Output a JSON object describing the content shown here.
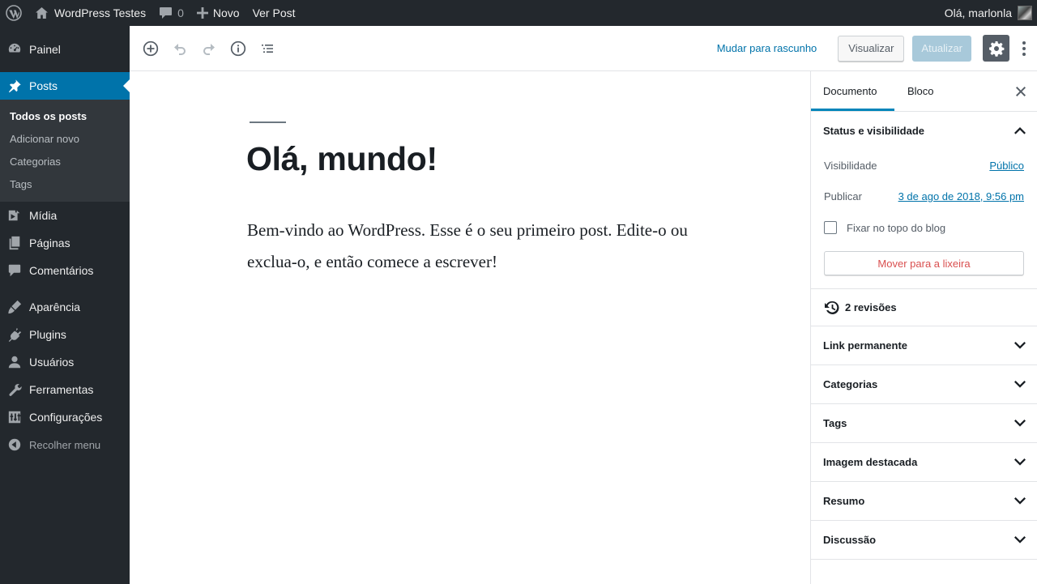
{
  "admin_bar": {
    "site_name": "WordPress Testes",
    "comments_count": "0",
    "new_label": "Novo",
    "view_post_label": "Ver Post",
    "greeting": "Olá, marlonla"
  },
  "sidebar": {
    "items": [
      {
        "label": "Painel",
        "icon": "dashboard-icon"
      },
      {
        "label": "Posts",
        "icon": "pin-icon"
      },
      {
        "label": "Mídia",
        "icon": "media-icon"
      },
      {
        "label": "Páginas",
        "icon": "pages-icon"
      },
      {
        "label": "Comentários",
        "icon": "comments-icon"
      },
      {
        "label": "Aparência",
        "icon": "appearance-icon"
      },
      {
        "label": "Plugins",
        "icon": "plugins-icon"
      },
      {
        "label": "Usuários",
        "icon": "users-icon"
      },
      {
        "label": "Ferramentas",
        "icon": "tools-icon"
      },
      {
        "label": "Configurações",
        "icon": "settings-icon"
      }
    ],
    "submenu": [
      "Todos os posts",
      "Adicionar novo",
      "Categorias",
      "Tags"
    ],
    "collapse_label": "Recolher menu"
  },
  "toolbar": {
    "switch_to_draft": "Mudar para rascunho",
    "preview": "Visualizar",
    "update": "Atualizar"
  },
  "post": {
    "title": "Olá, mundo!",
    "body": "Bem-vindo ao WordPress. Esse é o seu primeiro post. Edite-o ou exclua-o, e então comece a escrever!"
  },
  "panel": {
    "tabs": [
      "Documento",
      "Bloco"
    ],
    "status": {
      "title": "Status e visibilidade",
      "visibility_label": "Visibilidade",
      "visibility_value": "Público",
      "publish_label": "Publicar",
      "publish_value": "3 de ago de 2018, 9:56 pm",
      "sticky_label": "Fixar no topo do blog",
      "trash_label": "Mover para a lixeira"
    },
    "revisions": "2 revisões",
    "sections": [
      "Link permanente",
      "Categorias",
      "Tags",
      "Imagem destacada",
      "Resumo",
      "Discussão"
    ]
  },
  "colors": {
    "admin_dark": "#23282d",
    "submenu_bg": "#32373c",
    "accent": "#0073aa",
    "update_disabled": "#a8c9da",
    "trash_red": "#d94f4f"
  }
}
